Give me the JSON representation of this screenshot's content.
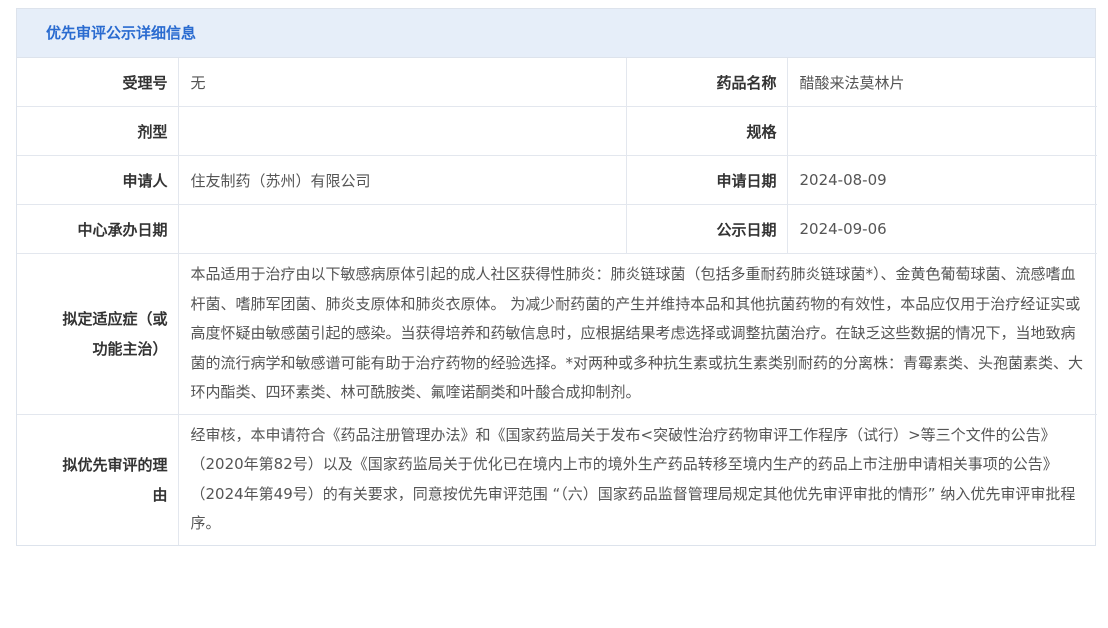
{
  "panel": {
    "title": "优先审评公示详细信息"
  },
  "rows": {
    "acceptance_no": {
      "label": "受理号",
      "value": "无"
    },
    "drug_name": {
      "label": "药品名称",
      "value": "醋酸来法莫林片"
    },
    "dosage_form": {
      "label": "剂型",
      "value": ""
    },
    "specification": {
      "label": "规格",
      "value": ""
    },
    "applicant": {
      "label": "申请人",
      "value": "住友制药（苏州）有限公司"
    },
    "application_date": {
      "label": "申请日期",
      "value": "2024-08-09"
    },
    "center_date": {
      "label": "中心承办日期",
      "value": ""
    },
    "publication_date": {
      "label": "公示日期",
      "value": "2024-09-06"
    },
    "indication": {
      "label_line1": "拟定适应症（或",
      "label_line2": "功能主治）",
      "text": "本品适用于治疗由以下敏感病原体引起的成人社区获得性肺炎：肺炎链球菌（包括多重耐药肺炎链球菌*）、金黄色葡萄球菌、流感嗜血杆菌、嗜肺军团菌、肺炎支原体和肺炎衣原体。 为减少耐药菌的产生并维持本品和其他抗菌药物的有效性，本品应仅用于治疗经证实或高度怀疑由敏感菌引起的感染。当获得培养和药敏信息时，应根据结果考虑选择或调整抗菌治疗。在缺乏这些数据的情况下，当地致病菌的流行病学和敏感谱可能有助于治疗药物的经验选择。*对两种或多种抗生素或抗生素类别耐药的分离株：青霉素类、头孢菌素类、大环内酯类、四环素类、林可酰胺类、氟喹诺酮类和叶酸合成抑制剂。"
    },
    "reason": {
      "label_line1": "拟优先审评的理",
      "label_line2": "由",
      "text": "经审核，本申请符合《药品注册管理办法》和《国家药监局关于发布<突破性治疗药物审评工作程序（试行）>等三个文件的公告》（2020年第82号）以及《国家药监局关于优化已在境内上市的境外生产药品转移至境内生产的药品上市注册申请相关事项的公告》（2024年第49号）的有关要求，同意按优先审评范围 “（六）国家药品监督管理局规定其他优先审评审批的情形” 纳入优先审评审批程序。"
    }
  }
}
